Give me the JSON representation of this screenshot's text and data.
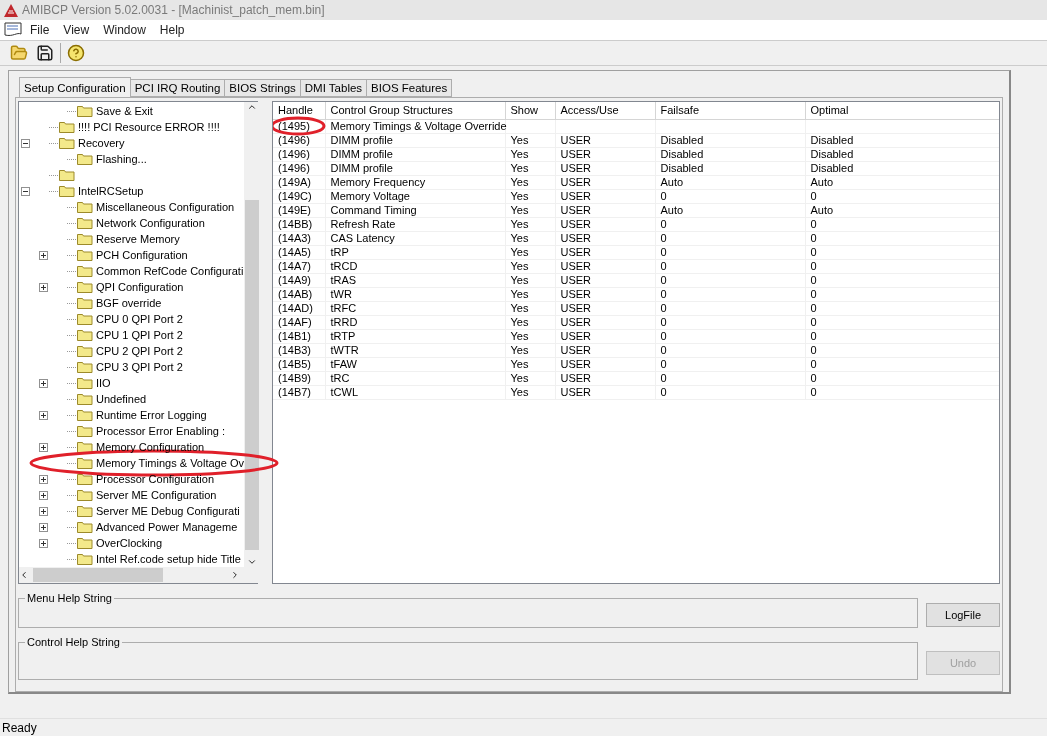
{
  "window": {
    "title": "AMIBCP Version 5.02.0031 - [Machinist_patch_mem.bin]"
  },
  "menu": [
    "File",
    "View",
    "Window",
    "Help"
  ],
  "tabs": [
    {
      "label": "Setup Configuration",
      "selected": true
    },
    {
      "label": "PCI IRQ Routing",
      "selected": false
    },
    {
      "label": "BIOS Strings",
      "selected": false
    },
    {
      "label": "DMI Tables",
      "selected": false
    },
    {
      "label": "BIOS Features",
      "selected": false
    }
  ],
  "tree": {
    "continued_children": [
      {
        "label": "Save & Exit",
        "circled": false
      }
    ],
    "items": [
      {
        "label": "!!!! PCI Resource ERROR !!!!",
        "circled": false
      },
      {
        "label": "Recovery",
        "expanded": true,
        "circled": false,
        "children": [
          {
            "label": "Flashing...",
            "circled": false
          }
        ]
      },
      {
        "circled": false
      },
      {
        "label": "IntelRCSetup",
        "expanded": true,
        "circled": false,
        "children": [
          {
            "label": "Miscellaneous Configuration",
            "circled": false
          },
          {
            "label": "Network Configuration",
            "circled": false
          },
          {
            "label": "Reserve Memory",
            "circled": false
          },
          {
            "label": "PCH Configuration",
            "expanded": false,
            "circled": false
          },
          {
            "label": "Common RefCode Configurati",
            "circled": false
          },
          {
            "label": "QPI Configuration",
            "expanded": false,
            "circled": false
          },
          {
            "label": "BGF override",
            "circled": false
          },
          {
            "label": "CPU 0 QPI Port 2",
            "circled": false
          },
          {
            "label": "CPU 1 QPI Port 2",
            "circled": false
          },
          {
            "label": "CPU 2 QPI Port 2",
            "circled": false
          },
          {
            "label": "CPU 3 QPI Port 2",
            "circled": false
          },
          {
            "label": "IIO",
            "expanded": false,
            "circled": false
          },
          {
            "label": "Undefined",
            "circled": false
          },
          {
            "label": "Runtime Error Logging",
            "expanded": false,
            "circled": false
          },
          {
            "label": "Processor Error Enabling :",
            "circled": false
          },
          {
            "label": "Memory Configuration",
            "expanded": false,
            "circled": false
          },
          {
            "label": "Memory Timings & Voltage Ov",
            "circled": true
          },
          {
            "label": "Processor Configuration",
            "expanded": false,
            "circled": false
          },
          {
            "label": "Server ME Configuration",
            "expanded": false,
            "circled": false
          },
          {
            "label": "Server ME Debug Configurati",
            "expanded": false,
            "circled": false
          },
          {
            "label": "Advanced Power Manageme",
            "expanded": false,
            "circled": false
          },
          {
            "label": "OverClocking",
            "expanded": false,
            "circled": false
          },
          {
            "label": "Intel Ref.code setup hide Title",
            "circled": false
          }
        ]
      }
    ]
  },
  "table": {
    "columns": [
      "Handle",
      "Control Group Structures",
      "Show",
      "Access/Use",
      "Failsafe",
      "Optimal"
    ],
    "rows": [
      {
        "cells": [
          "(1495)",
          "Memory Timings & Voltage Override",
          "",
          "",
          "",
          ""
        ],
        "circled": true
      },
      {
        "cells": [
          "(1496)",
          "DIMM profile",
          "Yes",
          "USER",
          "Disabled",
          "Disabled"
        ],
        "circled": false
      },
      {
        "cells": [
          "(1496)",
          "DIMM profile",
          "Yes",
          "USER",
          "Disabled",
          "Disabled"
        ],
        "circled": false
      },
      {
        "cells": [
          "(1496)",
          "DIMM profile",
          "Yes",
          "USER",
          "Disabled",
          "Disabled"
        ],
        "circled": false
      },
      {
        "cells": [
          "(149A)",
          "Memory Frequency",
          "Yes",
          "USER",
          "Auto",
          "Auto"
        ],
        "circled": false
      },
      {
        "cells": [
          "(149C)",
          "Memory Voltage",
          "Yes",
          "USER",
          "0",
          "0"
        ],
        "circled": false
      },
      {
        "cells": [
          "(149E)",
          "Command Timing",
          "Yes",
          "USER",
          "Auto",
          "Auto"
        ],
        "circled": false
      },
      {
        "cells": [
          "(14BB)",
          "Refresh Rate",
          "Yes",
          "USER",
          "0",
          "0"
        ],
        "circled": false
      },
      {
        "cells": [
          "(14A3)",
          "CAS Latency",
          "Yes",
          "USER",
          "0",
          "0"
        ],
        "circled": false
      },
      {
        "cells": [
          "(14A5)",
          "tRP",
          "Yes",
          "USER",
          "0",
          "0"
        ],
        "circled": false
      },
      {
        "cells": [
          "(14A7)",
          "tRCD",
          "Yes",
          "USER",
          "0",
          "0"
        ],
        "circled": false
      },
      {
        "cells": [
          "(14A9)",
          "tRAS",
          "Yes",
          "USER",
          "0",
          "0"
        ],
        "circled": false
      },
      {
        "cells": [
          "(14AB)",
          "tWR",
          "Yes",
          "USER",
          "0",
          "0"
        ],
        "circled": false
      },
      {
        "cells": [
          "(14AD)",
          "tRFC",
          "Yes",
          "USER",
          "0",
          "0"
        ],
        "circled": false
      },
      {
        "cells": [
          "(14AF)",
          "tRRD",
          "Yes",
          "USER",
          "0",
          "0"
        ],
        "circled": false
      },
      {
        "cells": [
          "(14B1)",
          "tRTP",
          "Yes",
          "USER",
          "0",
          "0"
        ],
        "circled": false
      },
      {
        "cells": [
          "(14B3)",
          "tWTR",
          "Yes",
          "USER",
          "0",
          "0"
        ],
        "circled": false
      },
      {
        "cells": [
          "(14B5)",
          "tFAW",
          "Yes",
          "USER",
          "0",
          "0"
        ],
        "circled": false
      },
      {
        "cells": [
          "(14B9)",
          "tRC",
          "Yes",
          "USER",
          "0",
          "0"
        ],
        "circled": false
      },
      {
        "cells": [
          "(14B7)",
          "tCWL",
          "Yes",
          "USER",
          "0",
          "0"
        ],
        "circled": false
      }
    ]
  },
  "help_groups": [
    {
      "legend": "Menu Help String",
      "button": {
        "label": "LogFile",
        "disabled": false
      }
    },
    {
      "legend": "Control Help String",
      "button": {
        "label": "Undo",
        "disabled": true
      }
    }
  ],
  "status_bar": "Ready"
}
